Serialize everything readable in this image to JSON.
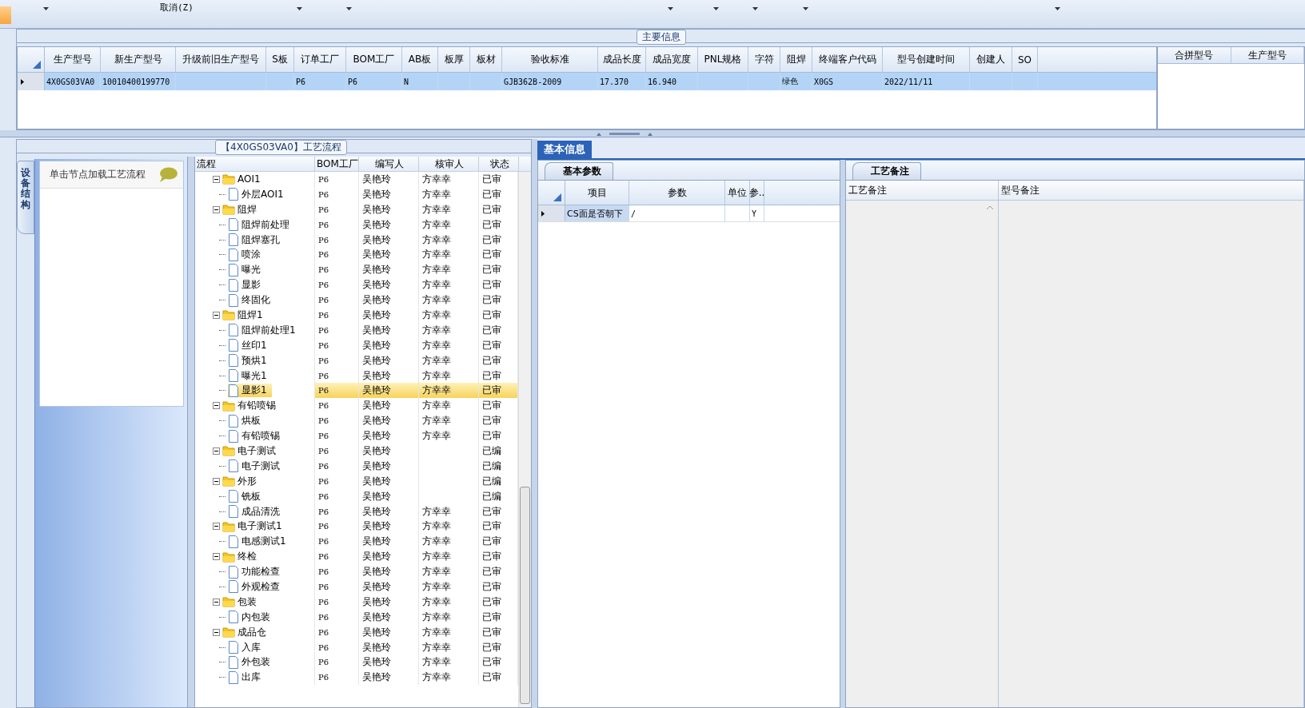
{
  "toolbar": {
    "cancel_label": "取消(Z)"
  },
  "main_info": {
    "legend": "主要信息",
    "columns": [
      "生产型号",
      "新生产型号",
      "升级前旧生产型号",
      "S板",
      "订单工厂",
      "BOM工厂",
      "AB板",
      "板厚",
      "板材",
      "验收标准",
      "成品长度",
      "成品宽度",
      "PNL规格",
      "字符",
      "阻焊",
      "终端客户代码",
      "型号创建时间",
      "创建人",
      "SO"
    ],
    "rows": [
      {
        "selected": true,
        "cells": [
          "4X0GS03VA0",
          "10010400199770",
          null,
          null,
          "P6",
          "P6",
          "N",
          null,
          null,
          "GJB362B-2009",
          "17.370",
          "16.940",
          null,
          null,
          "绿色",
          "X0GS",
          "2022/11/11",
          null,
          null
        ]
      }
    ],
    "side_columns": [
      "合拼型号",
      "生产型号"
    ]
  },
  "process": {
    "legend": "【4X0GS03VA0】工艺流程",
    "side_tab": "设备结构",
    "hint": "单击节点加载工艺流程",
    "columns": [
      "流程",
      "BOM工厂",
      "编写人",
      "核审人",
      "状态"
    ],
    "nodes": [
      {
        "name": "AOI1",
        "bom": "P6",
        "writer": "吴艳玲",
        "reviewer": "方幸幸",
        "status": "已审",
        "expanded": true,
        "selected": false,
        "children": [
          {
            "name": "外层AOI1",
            "bom": "P6",
            "writer": "吴艳玲",
            "reviewer": "方幸幸",
            "status": "已审",
            "selected": false
          }
        ]
      },
      {
        "name": "阻焊",
        "bom": "P6",
        "writer": "吴艳玲",
        "reviewer": "方幸幸",
        "status": "已审",
        "expanded": true,
        "selected": false,
        "children": [
          {
            "name": "阻焊前处理",
            "bom": "P6",
            "writer": "吴艳玲",
            "reviewer": "方幸幸",
            "status": "已审",
            "selected": false
          },
          {
            "name": "阻焊塞孔",
            "bom": "P6",
            "writer": "吴艳玲",
            "reviewer": "方幸幸",
            "status": "已审",
            "selected": false
          },
          {
            "name": "喷涂",
            "bom": "P6",
            "writer": "吴艳玲",
            "reviewer": "方幸幸",
            "status": "已审",
            "selected": false
          },
          {
            "name": "曝光",
            "bom": "P6",
            "writer": "吴艳玲",
            "reviewer": "方幸幸",
            "status": "已审",
            "selected": false
          },
          {
            "name": "显影",
            "bom": "P6",
            "writer": "吴艳玲",
            "reviewer": "方幸幸",
            "status": "已审",
            "selected": false
          },
          {
            "name": "终固化",
            "bom": "P6",
            "writer": "吴艳玲",
            "reviewer": "方幸幸",
            "status": "已审",
            "selected": false
          }
        ]
      },
      {
        "name": "阻焊1",
        "bom": "P6",
        "writer": "吴艳玲",
        "reviewer": "方幸幸",
        "status": "已审",
        "expanded": true,
        "selected": false,
        "children": [
          {
            "name": "阻焊前处理1",
            "bom": "P6",
            "writer": "吴艳玲",
            "reviewer": "方幸幸",
            "status": "已审",
            "selected": false
          },
          {
            "name": "丝印1",
            "bom": "P6",
            "writer": "吴艳玲",
            "reviewer": "方幸幸",
            "status": "已审",
            "selected": false
          },
          {
            "name": "预烘1",
            "bom": "P6",
            "writer": "吴艳玲",
            "reviewer": "方幸幸",
            "status": "已审",
            "selected": false
          },
          {
            "name": "曝光1",
            "bom": "P6",
            "writer": "吴艳玲",
            "reviewer": "方幸幸",
            "status": "已审",
            "selected": false
          },
          {
            "name": "显影1",
            "bom": "P6",
            "writer": "吴艳玲",
            "reviewer": "方幸幸",
            "status": "已审",
            "selected": true
          }
        ]
      },
      {
        "name": "有铅喷锡",
        "bom": "P6",
        "writer": "吴艳玲",
        "reviewer": "方幸幸",
        "status": "已审",
        "expanded": true,
        "selected": false,
        "children": [
          {
            "name": "烘板",
            "bom": "P6",
            "writer": "吴艳玲",
            "reviewer": "方幸幸",
            "status": "已审",
            "selected": false
          },
          {
            "name": "有铅喷锡",
            "bom": "P6",
            "writer": "吴艳玲",
            "reviewer": "方幸幸",
            "status": "已审",
            "selected": false
          }
        ]
      },
      {
        "name": "电子测试",
        "bom": "P6",
        "writer": "吴艳玲",
        "status": "已编",
        "expanded": true,
        "selected": false,
        "children": [
          {
            "name": "电子测试",
            "bom": "P6",
            "writer": "吴艳玲",
            "status": "已编",
            "selected": false
          }
        ]
      },
      {
        "name": "外形",
        "bom": "P6",
        "writer": "吴艳玲",
        "status": "已编",
        "expanded": true,
        "selected": false,
        "children": [
          {
            "name": "铣板",
            "bom": "P6",
            "writer": "吴艳玲",
            "status": "已编",
            "selected": false
          },
          {
            "name": "成品清洗",
            "bom": "P6",
            "writer": "吴艳玲",
            "reviewer": "方幸幸",
            "status": "已审",
            "selected": false
          }
        ]
      },
      {
        "name": "电子测试1",
        "bom": "P6",
        "writer": "吴艳玲",
        "reviewer": "方幸幸",
        "status": "已审",
        "expanded": true,
        "selected": false,
        "children": [
          {
            "name": "电感测试1",
            "bom": "P6",
            "writer": "吴艳玲",
            "reviewer": "方幸幸",
            "status": "已审",
            "selected": false
          }
        ]
      },
      {
        "name": "终检",
        "bom": "P6",
        "writer": "吴艳玲",
        "reviewer": "方幸幸",
        "status": "已审",
        "expanded": true,
        "selected": false,
        "children": [
          {
            "name": "功能检查",
            "bom": "P6",
            "writer": "吴艳玲",
            "reviewer": "方幸幸",
            "status": "已审",
            "selected": false
          },
          {
            "name": "外观检查",
            "bom": "P6",
            "writer": "吴艳玲",
            "reviewer": "方幸幸",
            "status": "已审",
            "selected": false
          }
        ]
      },
      {
        "name": "包装",
        "bom": "P6",
        "writer": "吴艳玲",
        "reviewer": "方幸幸",
        "status": "已审",
        "expanded": true,
        "selected": false,
        "children": [
          {
            "name": "内包装",
            "bom": "P6",
            "writer": "吴艳玲",
            "reviewer": "方幸幸",
            "status": "已审",
            "selected": false
          }
        ]
      },
      {
        "name": "成品仓",
        "bom": "P6",
        "writer": "吴艳玲",
        "reviewer": "方幸幸",
        "status": "已审",
        "expanded": true,
        "selected": false,
        "children": [
          {
            "name": "入库",
            "bom": "P6",
            "writer": "吴艳玲",
            "reviewer": "方幸幸",
            "status": "已审",
            "selected": false
          },
          {
            "name": "外包装",
            "bom": "P6",
            "writer": "吴艳玲",
            "reviewer": "方幸幸",
            "status": "已审",
            "selected": false
          },
          {
            "name": "出库",
            "bom": "P6",
            "writer": "吴艳玲",
            "reviewer": "方幸幸",
            "status": "已审",
            "selected": false
          }
        ]
      }
    ]
  },
  "basic_info": {
    "tab": "基本信息",
    "params_tab": "基本参数",
    "param_columns": [
      "项目",
      "参数",
      "单位",
      "参.."
    ],
    "param_rows": [
      {
        "cells": [
          "CS面是否朝下",
          "/",
          null,
          "Y"
        ]
      }
    ],
    "notes_tab": "工艺备注",
    "notes_columns": [
      "工艺备注",
      "型号备注"
    ]
  }
}
